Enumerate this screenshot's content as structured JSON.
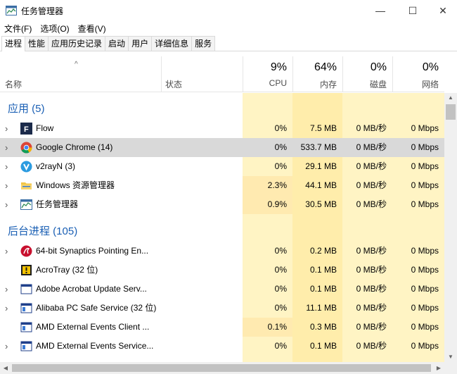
{
  "window": {
    "title": "任务管理器",
    "controls": {
      "minimize": "—",
      "maximize": "☐",
      "close": "✕"
    }
  },
  "menu": [
    "文件(F)",
    "选项(O)",
    "查看(V)"
  ],
  "tabs": [
    "进程",
    "性能",
    "应用历史记录",
    "启动",
    "用户",
    "详细信息",
    "服务"
  ],
  "active_tab": "进程",
  "columns": {
    "name": "名称",
    "status": "状态",
    "cpu": {
      "pct": "9%",
      "label": "CPU"
    },
    "memory": {
      "pct": "64%",
      "label": "内存"
    },
    "disk": {
      "pct": "0%",
      "label": "磁盘"
    },
    "network": {
      "pct": "0%",
      "label": "网络"
    }
  },
  "groups": {
    "apps": "应用 (5)",
    "background": "后台进程 (105)"
  },
  "apps": [
    {
      "name": "Flow",
      "icon": "flow-icon",
      "cpu": "0%",
      "mem": "7.5 MB",
      "disk": "0 MB/秒",
      "net": "0 Mbps",
      "expand": "›"
    },
    {
      "name": "Google Chrome (14)",
      "icon": "chrome-icon",
      "cpu": "0%",
      "mem": "533.7 MB",
      "disk": "0 MB/秒",
      "net": "0 Mbps",
      "expand": "›"
    },
    {
      "name": "v2rayN (3)",
      "icon": "v2rayn-icon",
      "cpu": "0%",
      "mem": "29.1 MB",
      "disk": "0 MB/秒",
      "net": "0 Mbps",
      "expand": "›"
    },
    {
      "name": "Windows 资源管理器",
      "icon": "folder-icon",
      "cpu": "2.3%",
      "mem": "44.1 MB",
      "disk": "0 MB/秒",
      "net": "0 Mbps",
      "expand": "›"
    },
    {
      "name": "任务管理器",
      "icon": "task-manager-icon",
      "cpu": "0.9%",
      "mem": "30.5 MB",
      "disk": "0 MB/秒",
      "net": "0 Mbps",
      "expand": "›"
    }
  ],
  "background": [
    {
      "name": "64-bit Synaptics Pointing En...",
      "icon": "synaptics-icon",
      "cpu": "0%",
      "mem": "0.2 MB",
      "disk": "0 MB/秒",
      "net": "0 Mbps",
      "expand": "›"
    },
    {
      "name": "AcroTray (32 位)",
      "icon": "acrotray-icon",
      "cpu": "0%",
      "mem": "0.1 MB",
      "disk": "0 MB/秒",
      "net": "0 Mbps",
      "expand": ""
    },
    {
      "name": "Adobe Acrobat Update Serv...",
      "icon": "window-icon",
      "cpu": "0%",
      "mem": "0.1 MB",
      "disk": "0 MB/秒",
      "net": "0 Mbps",
      "expand": "›"
    },
    {
      "name": "Alibaba PC Safe Service (32 位)",
      "icon": "window-icon",
      "cpu": "0%",
      "mem": "11.1 MB",
      "disk": "0 MB/秒",
      "net": "0 Mbps",
      "expand": "›"
    },
    {
      "name": "AMD External Events Client ...",
      "icon": "window-icon",
      "cpu": "0.1%",
      "mem": "0.3 MB",
      "disk": "0 MB/秒",
      "net": "0 Mbps",
      "expand": ""
    },
    {
      "name": "AMD External Events Service...",
      "icon": "window-icon",
      "cpu": "0%",
      "mem": "0.1 MB",
      "disk": "0 MB/秒",
      "net": "0 Mbps",
      "expand": "›"
    }
  ],
  "sort_indicator": "^",
  "colors": {
    "group": "#1a5fb4",
    "heat_light": "#fff4c4",
    "heat_mid": "#ffedab",
    "selected": "#d9d9d9"
  }
}
